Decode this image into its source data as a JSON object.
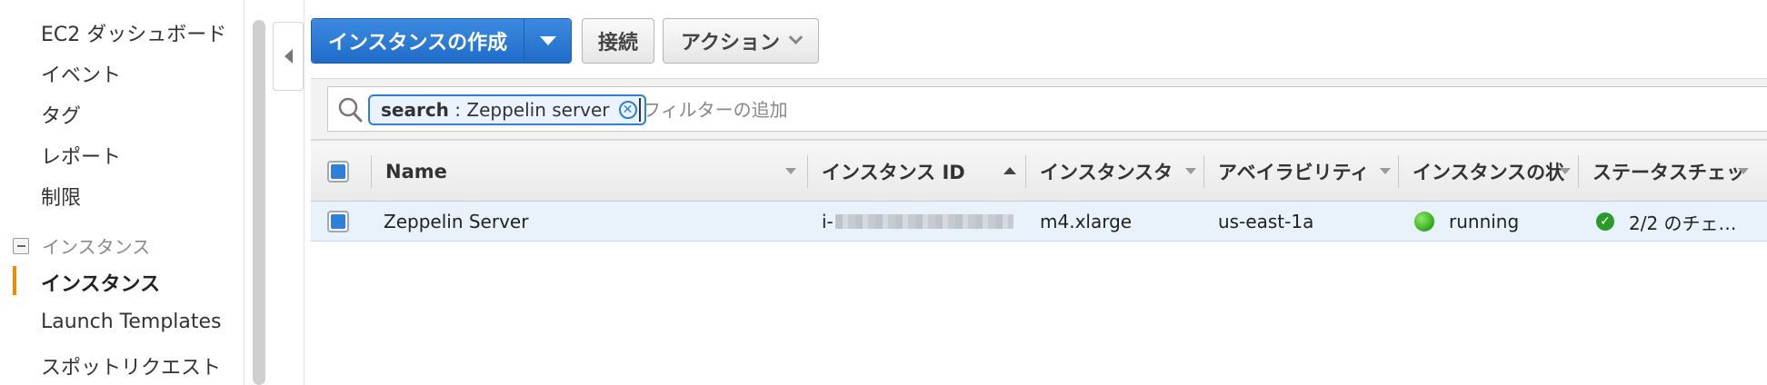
{
  "sidebar": {
    "items": [
      {
        "label": "EC2 ダッシュボード"
      },
      {
        "label": "イベント"
      },
      {
        "label": "タグ"
      },
      {
        "label": "レポート"
      },
      {
        "label": "制限"
      }
    ],
    "group": {
      "label": "インスタンス"
    },
    "group_items": [
      {
        "label": "インスタンス",
        "active": true
      },
      {
        "label": "Launch Templates"
      },
      {
        "label": "スポットリクエスト"
      }
    ]
  },
  "toolbar": {
    "launch_label": "インスタンスの作成",
    "connect_label": "接続",
    "actions_label": "アクション"
  },
  "filter": {
    "chip_key": "search",
    "chip_sep": " : ",
    "chip_value": "Zeppelin server",
    "placeholder": "フィルターの追加"
  },
  "table": {
    "columns": [
      {
        "label": "Name"
      },
      {
        "label": "インスタンス ID"
      },
      {
        "label": "インスタンスタ"
      },
      {
        "label": "アベイラビリティ"
      },
      {
        "label": "インスタンスの状"
      },
      {
        "label": "ステータスチェッ"
      }
    ],
    "rows": [
      {
        "name": "Zeppelin Server",
        "instance_id_prefix": "i-",
        "instance_type": "m4.xlarge",
        "availability_zone": "us-east-1a",
        "state": "running",
        "status_checks": "2/2 のチェ…"
      }
    ]
  },
  "colors": {
    "primary_button": "#1e6cc8",
    "running": "#2fa81a",
    "active_indicator": "#f08c00",
    "row_selected": "#e9f1fb"
  }
}
